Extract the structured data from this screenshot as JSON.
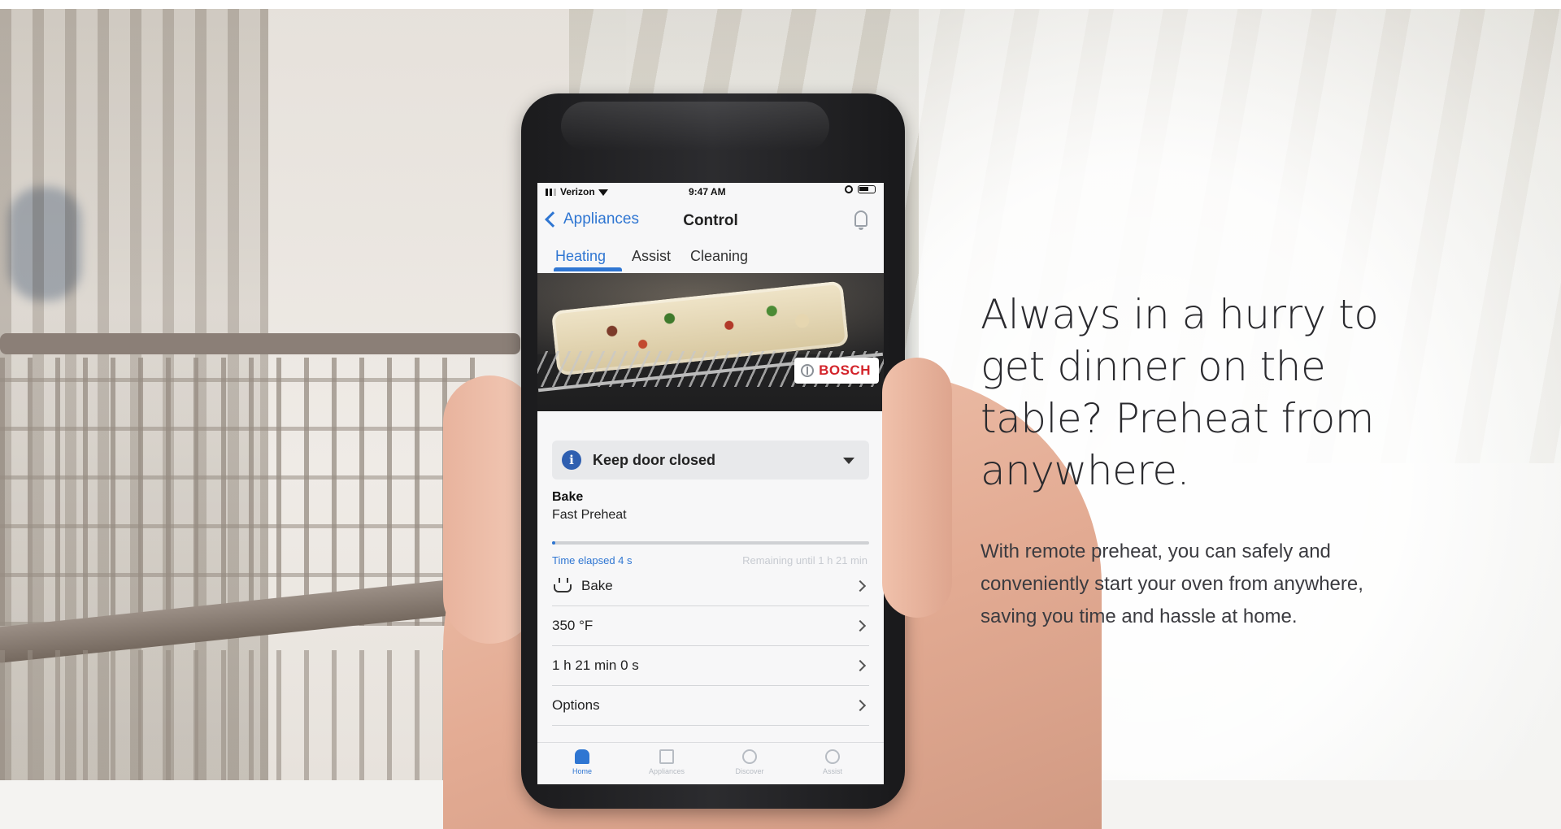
{
  "phone": {
    "status_bar": {
      "carrier": "Verizon",
      "time": "9:47 AM"
    },
    "nav": {
      "back_label": "Appliances",
      "title": "Control"
    },
    "tabs": [
      {
        "label": "Heating",
        "active": true
      },
      {
        "label": "Assist",
        "active": false
      },
      {
        "label": "Cleaning",
        "active": false
      }
    ],
    "brand_badge": "BOSCH",
    "notice": "Keep door closed",
    "program": {
      "name": "Bake",
      "mode": "Fast Preheat",
      "progress_fraction": 0.01,
      "time_elapsed": "Time elapsed 4 s",
      "time_remaining": "Remaining until 1 h 21 min"
    },
    "settings": [
      {
        "label": "Bake",
        "icon": "pot-icon"
      },
      {
        "label": "350 °F"
      },
      {
        "label": "1 h 21 min 0 s"
      },
      {
        "label": "Options"
      }
    ],
    "tab_bar": [
      {
        "label": "Home",
        "icon": "home-icon",
        "active": true
      },
      {
        "label": "Appliances",
        "icon": "appliance-icon",
        "active": false
      },
      {
        "label": "Discover",
        "icon": "compass-icon",
        "active": false
      },
      {
        "label": "Assist",
        "icon": "smile-icon",
        "active": false
      }
    ]
  },
  "marketing": {
    "headline_lines": [
      "Always in a hurry to",
      "get dinner on the",
      "table? Preheat from",
      "anywhere."
    ],
    "body_lines": [
      "With remote preheat, you can safely and",
      "conveniently start your oven from anywhere,",
      "saving you time and hassle at home."
    ]
  },
  "colors": {
    "accent": "#2f76d2",
    "brand_red": "#d3232a",
    "text_dark": "#2a2a2e"
  }
}
